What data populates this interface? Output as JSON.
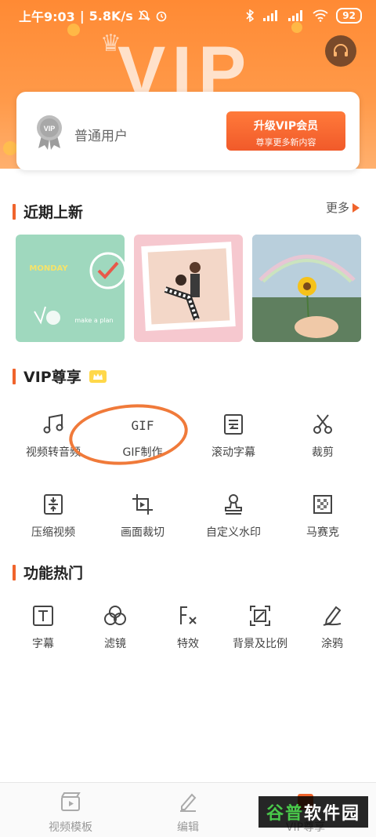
{
  "status_bar": {
    "time": "上午9:03",
    "speed": "5.8K/s",
    "battery": "92"
  },
  "header": {
    "watermark_text": "VIP"
  },
  "user_card": {
    "user_type": "普通用户",
    "upgrade_label": "升级VIP会员",
    "upgrade_subtitle": "尊享更多新内容"
  },
  "recent": {
    "title": "近期上新",
    "more_label": "更多",
    "thumbs": [
      {
        "caption_top": "MONDAY",
        "caption_bottom": "make a plan"
      },
      {
        "caption_top": "",
        "caption_bottom": ""
      },
      {
        "caption_top": "",
        "caption_bottom": ""
      }
    ]
  },
  "vip": {
    "title": "VIP尊享",
    "tools": [
      {
        "label": "视频转音频",
        "icon": "music-note-icon"
      },
      {
        "label": "GIF制作",
        "icon": "gif-icon"
      },
      {
        "label": "滚动字幕",
        "icon": "scroll-subtitle-icon"
      },
      {
        "label": "裁剪",
        "icon": "scissors-icon"
      },
      {
        "label": "压缩视频",
        "icon": "compress-icon"
      },
      {
        "label": "画面裁切",
        "icon": "crop-icon"
      },
      {
        "label": "自定义水印",
        "icon": "stamp-icon"
      },
      {
        "label": "马赛克",
        "icon": "mosaic-icon"
      }
    ]
  },
  "hot": {
    "title": "功能热门",
    "tools": [
      {
        "label": "字幕",
        "icon": "text-icon"
      },
      {
        "label": "滤镜",
        "icon": "filter-icon"
      },
      {
        "label": "特效",
        "icon": "fx-icon"
      },
      {
        "label": "背景及比例",
        "icon": "ratio-icon"
      },
      {
        "label": "涂鸦",
        "icon": "pen-icon"
      }
    ]
  },
  "gif_icon_text": "GIF",
  "bottom_nav": {
    "items": [
      {
        "label": "视频模板"
      },
      {
        "label": "编辑"
      },
      {
        "label": "VIP尊享"
      }
    ]
  },
  "watermark_logo": {
    "part1": "谷普",
    "part2": "软件园"
  },
  "colors": {
    "accent": "#f0642c",
    "header": "#ff8a34",
    "annotation": "#f07a3a"
  }
}
